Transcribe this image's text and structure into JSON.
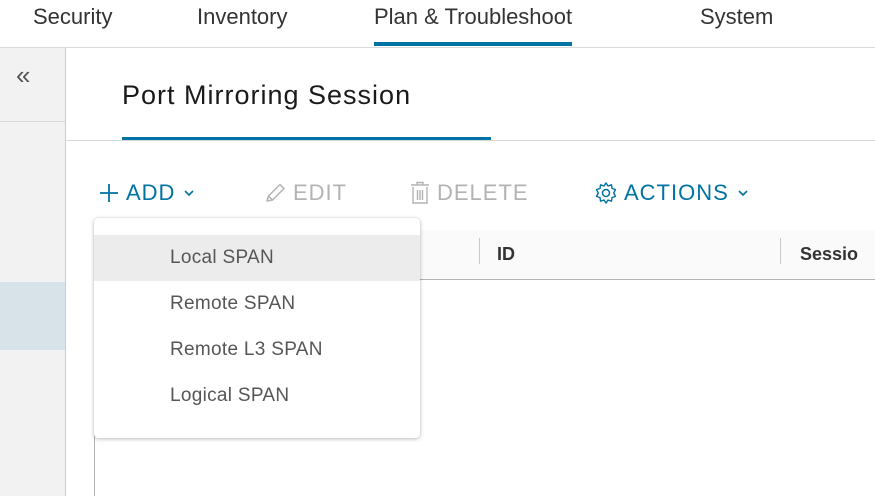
{
  "topnav": {
    "tabs": [
      {
        "label": "Security"
      },
      {
        "label": "Inventory"
      },
      {
        "label": "Plan & Troubleshoot",
        "active": true
      },
      {
        "label": "System"
      }
    ]
  },
  "sidebar": {
    "collapse_glyph": "«"
  },
  "page": {
    "title": "Port Mirroring Session"
  },
  "toolbar": {
    "add_label": "ADD",
    "edit_label": "EDIT",
    "delete_label": "DELETE",
    "actions_label": "ACTIONS",
    "caret_glyph": "⌄"
  },
  "grid": {
    "columns": [
      "ID",
      "Sessio"
    ]
  },
  "add_menu": {
    "items": [
      "Local SPAN",
      "Remote SPAN",
      "Remote L3 SPAN",
      "Logical SPAN"
    ]
  },
  "colors": {
    "accent": "#0072a3",
    "disabled": "#b3b3b3",
    "sidebar_selected": "#d8e3e9",
    "menu_hover": "#ececec"
  },
  "icons": [
    "plus-icon",
    "pencil-icon",
    "trash-icon",
    "gear-icon",
    "chevron-down-icon",
    "double-chevron-left-icon"
  ]
}
